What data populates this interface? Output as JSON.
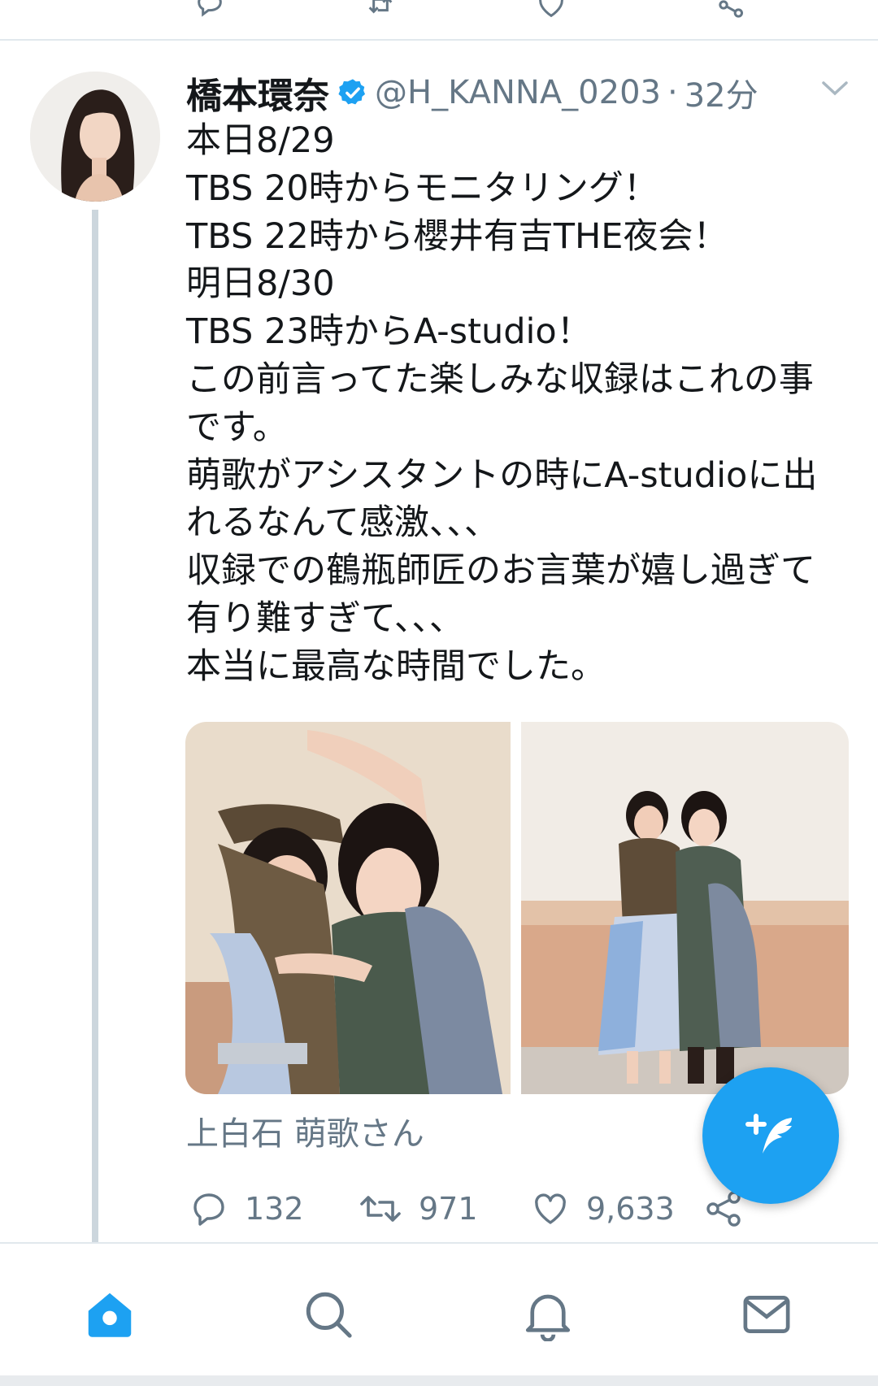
{
  "colors": {
    "accent": "#1da1f2",
    "verified": "#1da1f2",
    "text": "#14171a",
    "muted": "#657786",
    "divider": "#e1e8ed",
    "thread_line": "#ccd6dd"
  },
  "tweet": {
    "author_name": "橋本環奈",
    "handle": "@H_KANNA_0203",
    "separator": "·",
    "time": "32分",
    "lines": [
      "本日8/29",
      "TBS 20時からモニタリング！",
      "TBS 22時から櫻井有吉THE夜会！",
      "明日8/30",
      "TBS 23時からA-studio！",
      "この前言ってた楽しみな収録はこれの事",
      "です。",
      "萌歌がアシスタントの時にA-studioに出",
      "れるなんて感激、、、",
      "収録での鶴瓶師匠のお言葉が嬉し過ぎて",
      "有り難すぎて、、、",
      "本当に最高な時間でした。"
    ],
    "mention": "上白石 萌歌さん",
    "reply_count": "132",
    "retweet_count": "971",
    "like_count": "9,633"
  },
  "icons": {
    "verified": "verified-badge-icon",
    "caret": "chevron-down-icon",
    "reply": "reply-icon",
    "retweet": "retweet-icon",
    "like": "heart-icon",
    "share": "share-icon",
    "compose": "compose-tweet-icon",
    "nav": [
      "home-icon",
      "search-icon",
      "bell-icon",
      "mail-icon"
    ]
  }
}
